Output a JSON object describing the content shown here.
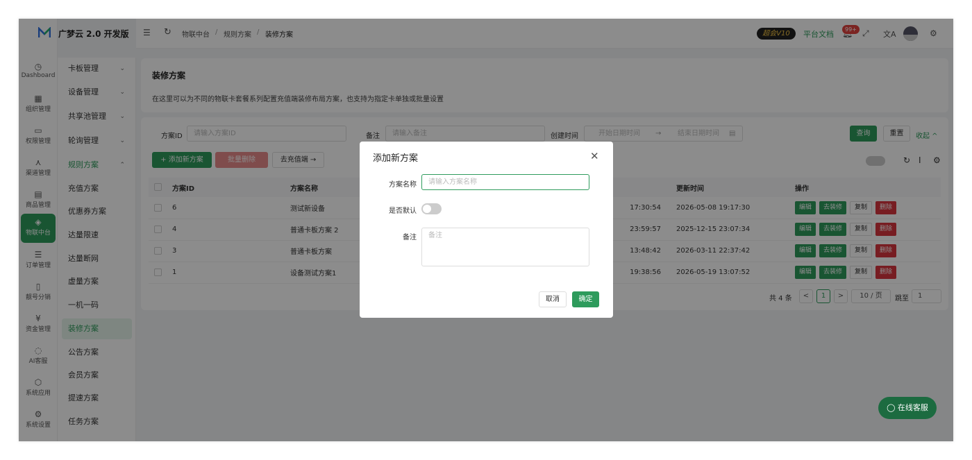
{
  "app": {
    "brand": "广梦云 2.0 开发版"
  },
  "rail": [
    {
      "label": "Dashboard",
      "icon": "dashboard-icon",
      "glyph": "◷"
    },
    {
      "label": "组织管理",
      "icon": "grid-icon",
      "glyph": "▦"
    },
    {
      "label": "权限管理",
      "icon": "monitor-icon",
      "glyph": "▭"
    },
    {
      "label": "渠道管理",
      "icon": "network-icon",
      "glyph": "⋏"
    },
    {
      "label": "商品管理",
      "icon": "shop-icon",
      "glyph": "▤"
    },
    {
      "label": "物联中台",
      "icon": "iot-icon",
      "glyph": "◈"
    },
    {
      "label": "订单管理",
      "icon": "list-icon",
      "glyph": "☰"
    },
    {
      "label": "靓号分销",
      "icon": "phone-icon",
      "glyph": "▯"
    },
    {
      "label": "资金管理",
      "icon": "money-icon",
      "glyph": "¥"
    },
    {
      "label": "AI客服",
      "icon": "ai-icon",
      "glyph": "◌"
    },
    {
      "label": "系统应用",
      "icon": "apps-icon",
      "glyph": "⬡"
    },
    {
      "label": "系统设置",
      "icon": "settings-icon",
      "glyph": "⚙"
    }
  ],
  "menu": [
    {
      "label": "卡板管理",
      "chevron": "⌄"
    },
    {
      "label": "设备管理",
      "chevron": "⌄"
    },
    {
      "label": "共享池管理",
      "chevron": "⌄"
    },
    {
      "label": "轮询管理",
      "chevron": "⌄"
    },
    {
      "label": "规则方案",
      "chevron": "⌃"
    },
    {
      "label": "充值方案"
    },
    {
      "label": "优惠券方案"
    },
    {
      "label": "达量限速"
    },
    {
      "label": "达量断网"
    },
    {
      "label": "虚量方案"
    },
    {
      "label": "一机一码"
    },
    {
      "label": "装修方案"
    },
    {
      "label": "公告方案"
    },
    {
      "label": "会员方案"
    },
    {
      "label": "提速方案"
    },
    {
      "label": "任务方案"
    }
  ],
  "topbar": {
    "breadcrumb": [
      "物联中台",
      "/",
      "规则方案",
      "/",
      "装修方案"
    ],
    "vip": "超会V10",
    "docs": "平台文档",
    "badge": "99+"
  },
  "page": {
    "title": "装修方案",
    "desc": "在这里可以为不同的物联卡套餐系列配置充值端装修布局方案，也支持为指定卡单独或批量设置"
  },
  "filters": {
    "id_label": "方案ID",
    "id_ph": "请输入方案ID",
    "note_label": "备注",
    "note_ph": "请输入备注",
    "time_label": "创建时间",
    "start_ph": "开始日期时间",
    "arrow": "→",
    "end_ph": "结束日期时间",
    "query": "查询",
    "reset": "重置",
    "collapse": "收起 ^"
  },
  "toolbar": {
    "add": "+ 添加新方案",
    "batch_delete": "批量删除",
    "goto": "去充值端 →"
  },
  "table": {
    "headers": [
      "方案ID",
      "方案名称",
      "更新时间",
      "操作"
    ],
    "rows": [
      {
        "id": "6",
        "name": "测试新设备",
        "created": "17:30:54",
        "updated": "2026-05-08 19:17:30"
      },
      {
        "id": "4",
        "name": "普通卡板方案 2",
        "created": "23:59:57",
        "updated": "2025-12-15 23:07:34"
      },
      {
        "id": "3",
        "name": "普通卡板方案",
        "created": "13:48:42",
        "updated": "2026-03-11 22:37:42"
      },
      {
        "id": "1",
        "name": "设备测试方案1",
        "created": "19:38:56",
        "updated": "2026-05-19 13:07:52"
      }
    ],
    "actions": {
      "edit": "编辑",
      "decorate": "去装修",
      "copy": "复制",
      "delete": "删除"
    }
  },
  "pagination": {
    "total": "共 4 条",
    "prev": "<",
    "page": "1",
    "next": ">",
    "size": "10 / 页",
    "jump_label": "跳至",
    "jump_value": "1"
  },
  "modal": {
    "title": "添加新方案",
    "name_label": "方案名称",
    "name_ph": "请输入方案名称",
    "default_label": "是否默认",
    "note_label": "备注",
    "note_ph": "备注",
    "cancel": "取消",
    "ok": "确定"
  },
  "fab": "在线客服",
  "colors": {
    "primary": "#2e9b5c",
    "danger": "#d9363e"
  }
}
